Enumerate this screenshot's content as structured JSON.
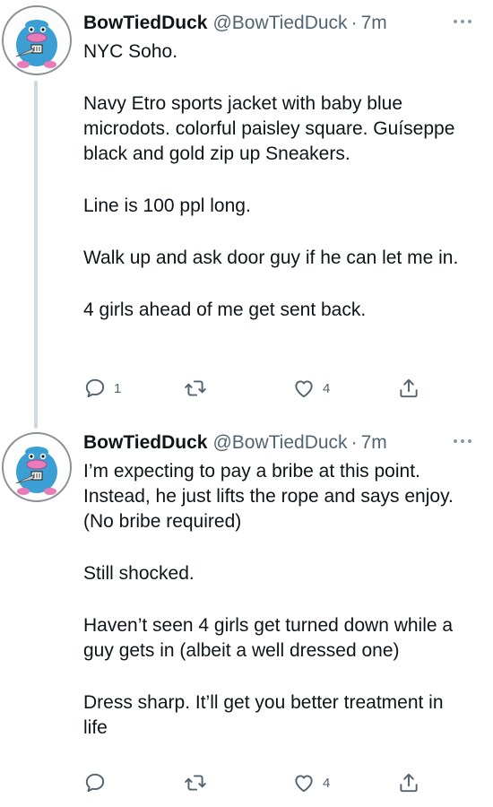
{
  "thread": [
    {
      "author": {
        "display_name": "BowTiedDuck",
        "handle": "@BowTiedDuck",
        "avatar_icon": "duck-with-knife-avatar"
      },
      "separator": "·",
      "time": "7m",
      "paragraphs": [
        "NYC Soho.",
        "Navy Etro sports jacket with baby blue microdots. colorful paisley square. Guíseppe black and gold zip up Sneakers.",
        "Line is 100 ppl long.",
        "Walk up and ask door guy if he can let me in.",
        "4 girls ahead of me get sent back."
      ],
      "actions": {
        "reply_count": "1",
        "retweet_count": "",
        "like_count": "4"
      }
    },
    {
      "author": {
        "display_name": "BowTiedDuck",
        "handle": "@BowTiedDuck",
        "avatar_icon": "duck-with-knife-avatar"
      },
      "separator": "·",
      "time": "7m",
      "paragraphs": [
        "I’m expecting to pay a bribe at this point. Instead, he just lifts the rope and says enjoy. (No bribe required)",
        "Still shocked.",
        "Haven’t seen 4 girls get turned down while a guy gets in (albeit a well dressed one)",
        "Dress sharp. It’ll get you better treatment in life"
      ],
      "actions": {
        "reply_count": "",
        "retweet_count": "",
        "like_count": "4"
      }
    }
  ],
  "icons": {
    "more": "more-horizontal-icon",
    "reply": "reply-bubble-icon",
    "retweet": "retweet-arrows-icon",
    "like": "heart-icon",
    "share": "share-upload-icon"
  },
  "colors": {
    "text_primary": "#0f1419",
    "text_secondary": "#536471",
    "thread_line": "#cfd9de",
    "duck_blue": "#3c9fd4",
    "duck_beak": "#e87bb8"
  }
}
